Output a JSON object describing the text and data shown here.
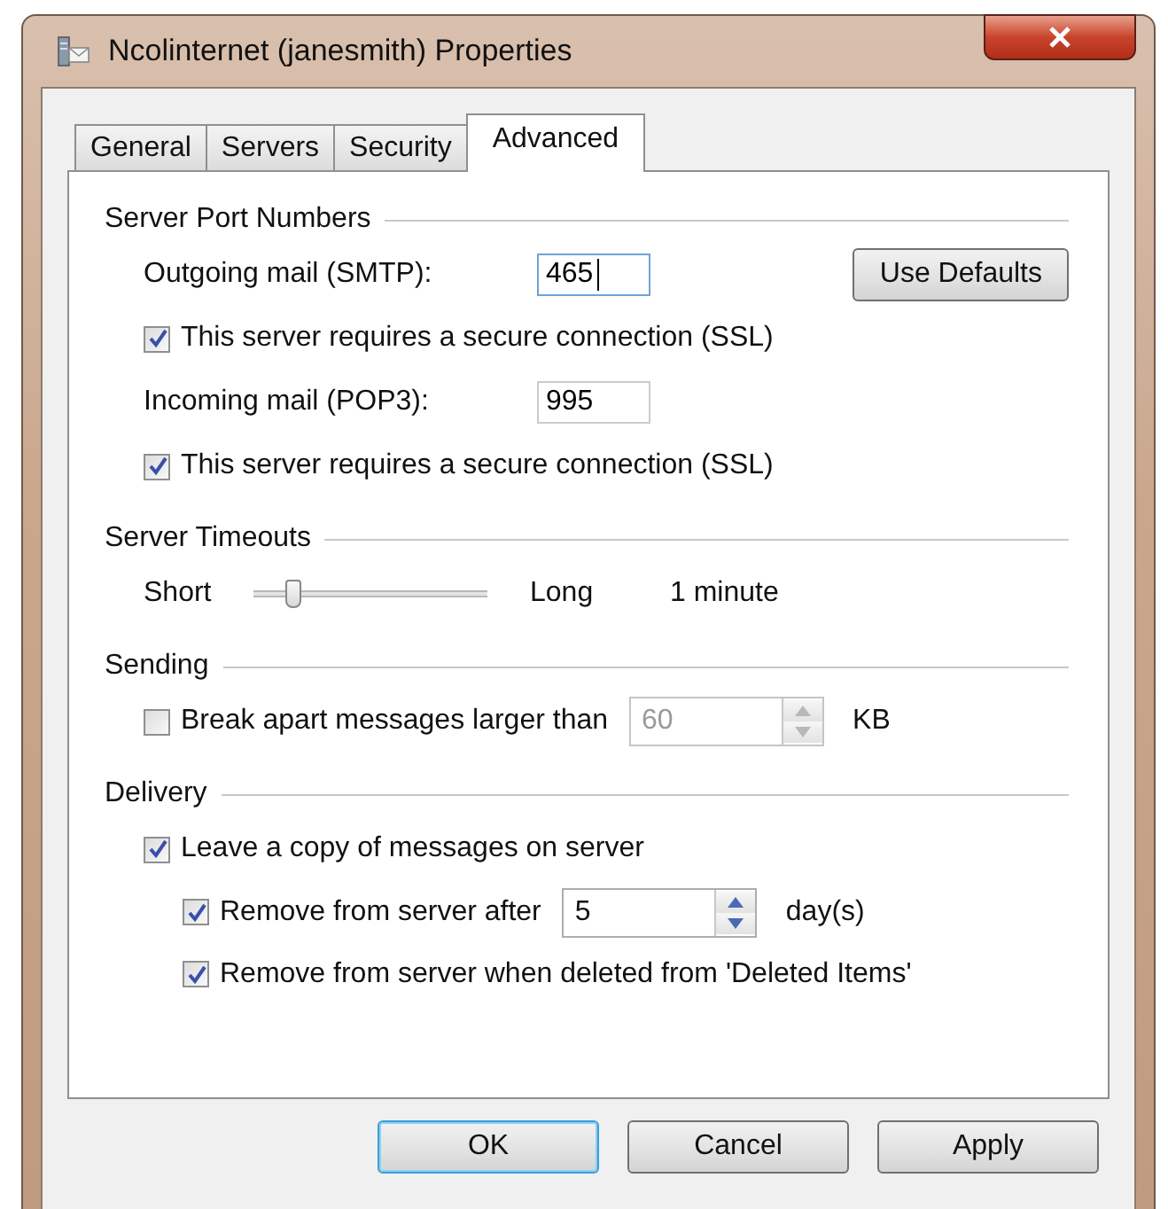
{
  "window": {
    "title": "Ncolinternet (janesmith) Properties"
  },
  "tabs": [
    {
      "label": "General",
      "selected": false
    },
    {
      "label": "Servers",
      "selected": false
    },
    {
      "label": "Security",
      "selected": false
    },
    {
      "label": "Advanced",
      "selected": true
    }
  ],
  "sections": [
    {
      "title": "Server Port Numbers",
      "rows": [
        {
          "kind": "port",
          "label": "Outgoing mail (SMTP):",
          "value": "465",
          "focused": true,
          "button": "Use Defaults"
        },
        {
          "kind": "checkbox",
          "label": "This server requires a secure connection (SSL)",
          "checked": true
        },
        {
          "kind": "port",
          "label": "Incoming mail (POP3):",
          "value": "995",
          "focused": false
        },
        {
          "kind": "checkbox",
          "label": "This server requires a secure connection (SSL)",
          "checked": true
        }
      ]
    },
    {
      "title": "Server Timeouts",
      "rows": [
        {
          "kind": "slider",
          "min_label": "Short",
          "max_label": "Long",
          "level": 0.15,
          "reading": "1 minute"
        }
      ]
    },
    {
      "title": "Sending",
      "rows": [
        {
          "kind": "checkbox_spin",
          "label": "Break apart messages larger than",
          "checked": false,
          "value": "60",
          "disabled": true,
          "unit": "KB"
        }
      ]
    },
    {
      "title": "Delivery",
      "rows": [
        {
          "kind": "checkbox",
          "label": "Leave a copy of messages on server",
          "checked": true,
          "children": [
            {
              "kind": "checkbox_spin",
              "label": "Remove from server after",
              "checked": true,
              "value": "5",
              "disabled": false,
              "unit": "day(s)"
            },
            {
              "kind": "checkbox",
              "label": "Remove from server when deleted from 'Deleted Items'",
              "checked": true
            }
          ]
        }
      ]
    }
  ],
  "buttons": [
    {
      "label": "OK",
      "default": true
    },
    {
      "label": "Cancel",
      "default": false
    },
    {
      "label": "Apply",
      "default": false
    }
  ]
}
